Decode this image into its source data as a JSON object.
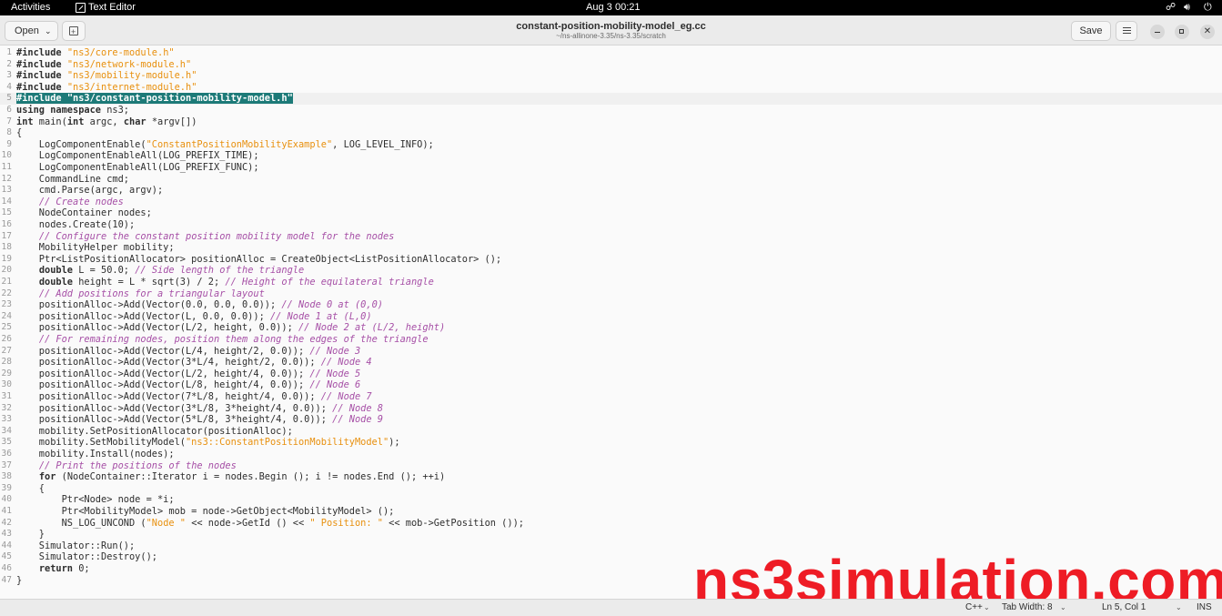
{
  "topbar": {
    "activities": "Activities",
    "app_name": "Text Editor",
    "date": "Aug 3",
    "time": "00:21",
    "icons": [
      "network-icon",
      "volume-icon",
      "power-icon"
    ]
  },
  "header": {
    "open_label": "Open",
    "title": "constant-position-mobility-model_eg.cc",
    "subtitle": "~/ns-allinone-3.35/ns-3.35/scratch",
    "save_label": "Save"
  },
  "editor": {
    "current_line": 5,
    "lines": [
      {
        "n": "1",
        "c": "<span class=\"k\">#include</span> <span class=\"s\">\"ns3/core-module.h\"</span>"
      },
      {
        "n": "2",
        "c": "<span class=\"k\">#include</span> <span class=\"s\">\"ns3/network-module.h\"</span>"
      },
      {
        "n": "3",
        "c": "<span class=\"k\">#include</span> <span class=\"s\">\"ns3/mobility-module.h\"</span>"
      },
      {
        "n": "4",
        "c": "<span class=\"k\">#include</span> <span class=\"s\">\"ns3/internet-module.h\"</span>"
      },
      {
        "n": "5",
        "c": "<span class=\"selected\"><span class=\"k\">#include</span> <span class=\"s\">\"ns3/constant-position-mobility-model.h\"</span></span>"
      },
      {
        "n": "6",
        "c": "<span class=\"k\">using namespace</span> ns3;"
      },
      {
        "n": "7",
        "c": "<span class=\"k\">int</span> main(<span class=\"k\">int</span> argc, <span class=\"k\">char</span> *argv[])"
      },
      {
        "n": "8",
        "c": "{"
      },
      {
        "n": "9",
        "c": "    LogComponentEnable(<span class=\"s\">\"ConstantPositionMobilityExample\"</span>, LOG_LEVEL_INFO);"
      },
      {
        "n": "10",
        "c": "    LogComponentEnableAll(LOG_PREFIX_TIME);"
      },
      {
        "n": "11",
        "c": "    LogComponentEnableAll(LOG_PREFIX_FUNC);"
      },
      {
        "n": "12",
        "c": "    CommandLine cmd;"
      },
      {
        "n": "13",
        "c": "    cmd.Parse(argc, argv);"
      },
      {
        "n": "14",
        "c": "    <span class=\"c\">// Create nodes</span>"
      },
      {
        "n": "15",
        "c": "    NodeContainer nodes;"
      },
      {
        "n": "16",
        "c": "    nodes.Create(10);"
      },
      {
        "n": "17",
        "c": "    <span class=\"c\">// Configure the constant position mobility model for the nodes</span>"
      },
      {
        "n": "18",
        "c": "    MobilityHelper mobility;"
      },
      {
        "n": "19",
        "c": "    Ptr&lt;ListPositionAllocator&gt; positionAlloc = CreateObject&lt;ListPositionAllocator&gt; ();"
      },
      {
        "n": "20",
        "c": "    <span class=\"k\">double</span> L = 50.0; <span class=\"c\">// Side length of the triangle</span>"
      },
      {
        "n": "21",
        "c": "    <span class=\"k\">double</span> height = L * sqrt(3) / 2; <span class=\"c\">// Height of the equilateral triangle</span>"
      },
      {
        "n": "22",
        "c": "    <span class=\"c\">// Add positions for a triangular layout</span>"
      },
      {
        "n": "23",
        "c": "    positionAlloc-&gt;Add(Vector(0.0, 0.0, 0.0)); <span class=\"c\">// Node 0 at (0,0)</span>"
      },
      {
        "n": "24",
        "c": "    positionAlloc-&gt;Add(Vector(L, 0.0, 0.0)); <span class=\"c\">// Node 1 at (L,0)</span>"
      },
      {
        "n": "25",
        "c": "    positionAlloc-&gt;Add(Vector(L/2, height, 0.0)); <span class=\"c\">// Node 2 at (L/2, height)</span>"
      },
      {
        "n": "26",
        "c": "    <span class=\"c\">// For remaining nodes, position them along the edges of the triangle</span>"
      },
      {
        "n": "27",
        "c": "    positionAlloc-&gt;Add(Vector(L/4, height/2, 0.0)); <span class=\"c\">// Node 3</span>"
      },
      {
        "n": "28",
        "c": "    positionAlloc-&gt;Add(Vector(3*L/4, height/2, 0.0)); <span class=\"c\">// Node 4</span>"
      },
      {
        "n": "29",
        "c": "    positionAlloc-&gt;Add(Vector(L/2, height/4, 0.0)); <span class=\"c\">// Node 5</span>"
      },
      {
        "n": "30",
        "c": "    positionAlloc-&gt;Add(Vector(L/8, height/4, 0.0)); <span class=\"c\">// Node 6</span>"
      },
      {
        "n": "31",
        "c": "    positionAlloc-&gt;Add(Vector(7*L/8, height/4, 0.0)); <span class=\"c\">// Node 7</span>"
      },
      {
        "n": "32",
        "c": "    positionAlloc-&gt;Add(Vector(3*L/8, 3*height/4, 0.0)); <span class=\"c\">// Node 8</span>"
      },
      {
        "n": "33",
        "c": "    positionAlloc-&gt;Add(Vector(5*L/8, 3*height/4, 0.0)); <span class=\"c\">// Node 9</span>"
      },
      {
        "n": "34",
        "c": "    mobility.SetPositionAllocator(positionAlloc);"
      },
      {
        "n": "35",
        "c": "    mobility.SetMobilityModel(<span class=\"s\">\"ns3::ConstantPositionMobilityModel\"</span>);"
      },
      {
        "n": "36",
        "c": "    mobility.Install(nodes);"
      },
      {
        "n": "37",
        "c": "    <span class=\"c\">// Print the positions of the nodes</span>"
      },
      {
        "n": "38",
        "c": "    <span class=\"k\">for</span> (NodeContainer::Iterator i = nodes.Begin (); i != nodes.End (); ++i)"
      },
      {
        "n": "39",
        "c": "    {"
      },
      {
        "n": "40",
        "c": "        Ptr&lt;Node&gt; node = *i;"
      },
      {
        "n": "41",
        "c": "        Ptr&lt;MobilityModel&gt; mob = node-&gt;GetObject&lt;MobilityModel&gt; ();"
      },
      {
        "n": "42",
        "c": "        NS_LOG_UNCOND (<span class=\"s\">\"Node \"</span> &lt;&lt; node-&gt;GetId () &lt;&lt; <span class=\"s\">\" Position: \"</span> &lt;&lt; mob-&gt;GetPosition ());"
      },
      {
        "n": "43",
        "c": "    }"
      },
      {
        "n": "44",
        "c": "    Simulator::Run();"
      },
      {
        "n": "45",
        "c": "    Simulator::Destroy();"
      },
      {
        "n": "46",
        "c": "    <span class=\"k\">return</span> 0;"
      },
      {
        "n": "47",
        "c": "}"
      }
    ]
  },
  "watermark": "ns3simulation.com",
  "status": {
    "language": "C++",
    "tab_width": "Tab Width: 8",
    "position": "Ln 5, Col 1",
    "mode": "INS"
  },
  "colors": {
    "selection": "#1d7a78",
    "string": "#e8900e",
    "comment": "#a64fa6",
    "watermark": "#ee1c25"
  }
}
